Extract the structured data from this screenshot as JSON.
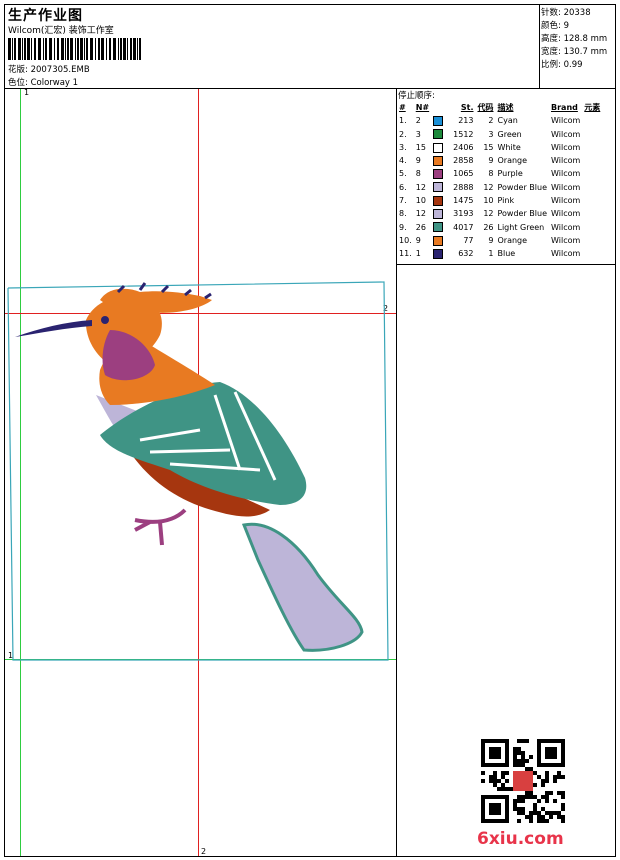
{
  "header": {
    "title": "生产作业图",
    "company": "Wilcom(汇宏) 装饰工作室",
    "design_label": "花版:",
    "design_value": "2007305.EMB",
    "colorway_label": "色位:",
    "colorway_value": "Colorway 1"
  },
  "stats": {
    "stitches_label": "针数:",
    "stitches_value": "20338",
    "colors_label": "颜色:",
    "colors_value": "9",
    "height_label": "高度:",
    "height_value": "128.8 mm",
    "width_label": "宽度:",
    "width_value": "130.7 mm",
    "ratio_label": "比例:",
    "ratio_value": "0.99"
  },
  "stop_sequence": {
    "heading": "停止顺序:",
    "columns": [
      "#",
      "N#",
      "St.",
      "代码",
      "描述",
      "Brand",
      "元素"
    ],
    "rows": [
      {
        "idx": "1.",
        "n": "2",
        "color": "#1a8fd6",
        "st": "213",
        "code": "2",
        "desc": "Cyan",
        "brand": "Wilcom"
      },
      {
        "idx": "2.",
        "n": "3",
        "color": "#1d8a3c",
        "st": "1512",
        "code": "3",
        "desc": "Green",
        "brand": "Wilcom"
      },
      {
        "idx": "3.",
        "n": "15",
        "color": "#ffffff",
        "st": "2406",
        "code": "15",
        "desc": "White",
        "brand": "Wilcom"
      },
      {
        "idx": "4.",
        "n": "9",
        "color": "#e87a22",
        "st": "2858",
        "code": "9",
        "desc": "Orange",
        "brand": "Wilcom"
      },
      {
        "idx": "5.",
        "n": "8",
        "color": "#9c3f80",
        "st": "1065",
        "code": "8",
        "desc": "Purple",
        "brand": "Wilcom"
      },
      {
        "idx": "6.",
        "n": "12",
        "color": "#bdb5d8",
        "st": "2888",
        "code": "12",
        "desc": "Powder Blue",
        "brand": "Wilcom"
      },
      {
        "idx": "7.",
        "n": "10",
        "color": "#a6360f",
        "st": "1475",
        "code": "10",
        "desc": "Pink",
        "brand": "Wilcom"
      },
      {
        "idx": "8.",
        "n": "12",
        "color": "#bdb5d8",
        "st": "3193",
        "code": "12",
        "desc": "Powder Blue",
        "brand": "Wilcom"
      },
      {
        "idx": "9.",
        "n": "26",
        "color": "#3f9485",
        "st": "4017",
        "code": "26",
        "desc": "Light Green",
        "brand": "Wilcom"
      },
      {
        "idx": "10.",
        "n": "9",
        "color": "#e87a22",
        "st": "77",
        "code": "9",
        "desc": "Orange",
        "brand": "Wilcom"
      },
      {
        "idx": "11.",
        "n": "1",
        "color": "#2a2370",
        "st": "632",
        "code": "1",
        "desc": "Blue",
        "brand": "Wilcom"
      }
    ]
  },
  "guides": {
    "vertical_green_label": "1",
    "horizontal_green_label": "1",
    "vertical_red_label": "2",
    "horizontal_red_label": "2"
  },
  "watermark": "6xiu.com",
  "colors": {
    "guide_green": "#2ecc40",
    "guide_red": "#e02020",
    "hoop_teal": "#3aa6b8"
  }
}
